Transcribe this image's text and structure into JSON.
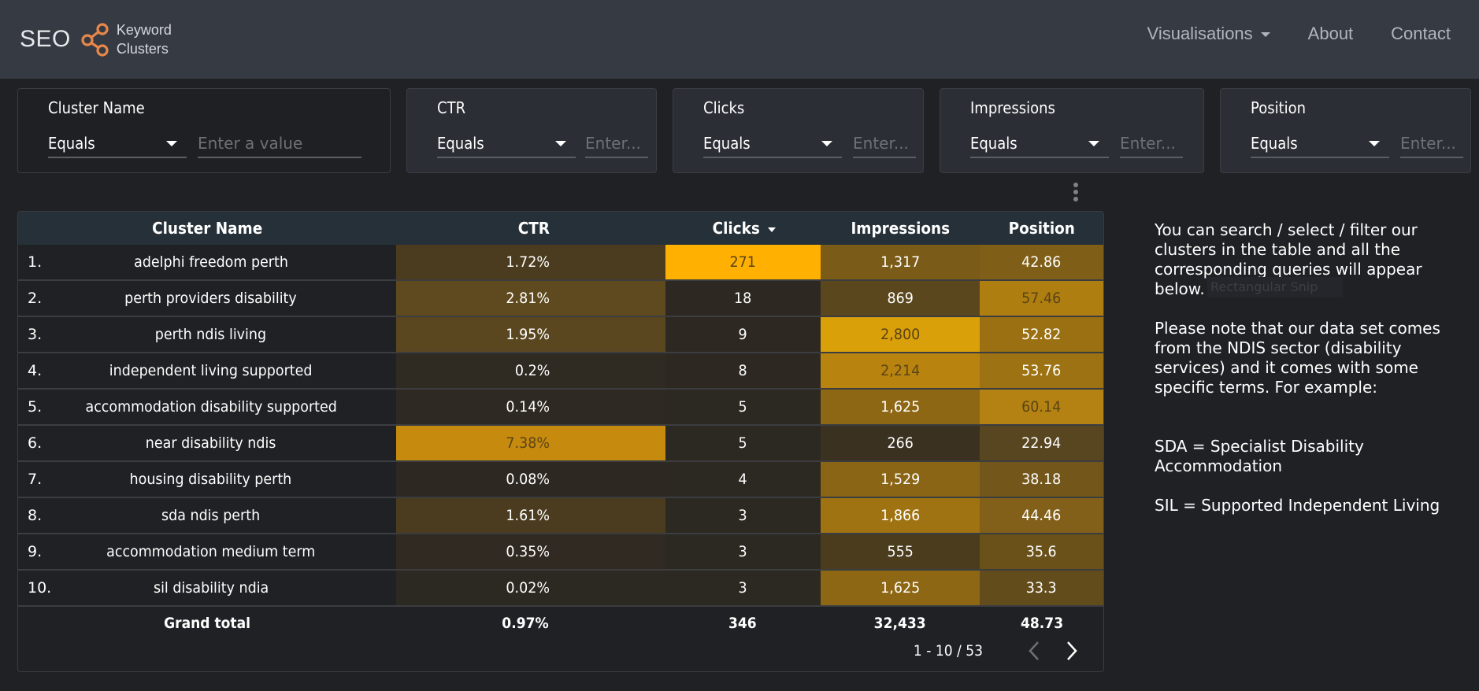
{
  "header": {
    "logo": {
      "seo": "SEO",
      "line1": "Keyword",
      "line2": "Clusters",
      "icon": "share-nodes-icon",
      "accent": "#e8874a"
    },
    "nav": [
      {
        "label": "Visualisations",
        "dropdown": true
      },
      {
        "label": "About"
      },
      {
        "label": "Contact"
      }
    ]
  },
  "filters": [
    {
      "label": "Cluster Name",
      "operator": "Equals",
      "value": "",
      "placeholder": "Enter a value"
    },
    {
      "label": "CTR",
      "operator": "Equals",
      "value": "",
      "placeholder": "Enter..."
    },
    {
      "label": "Clicks",
      "operator": "Equals",
      "value": "",
      "placeholder": "Enter..."
    },
    {
      "label": "Impressions",
      "operator": "Equals",
      "value": "",
      "placeholder": "Enter..."
    },
    {
      "label": "Position",
      "operator": "Equals",
      "value": "",
      "placeholder": "Enter..."
    }
  ],
  "table": {
    "columns": [
      "Cluster Name",
      "CTR",
      "Clicks",
      "Impressions",
      "Position"
    ],
    "sorted_by": "Clicks",
    "sort_direction": "descending",
    "rows": [
      {
        "index": "1.",
        "name": "adelphi freedom perth",
        "ctr": "1.72%",
        "clicks": "271",
        "impressions": "1,317",
        "position": "42.86"
      },
      {
        "index": "2.",
        "name": "perth providers disability",
        "ctr": "2.81%",
        "clicks": "18",
        "impressions": "869",
        "position": "57.46"
      },
      {
        "index": "3.",
        "name": "perth ndis living",
        "ctr": "1.95%",
        "clicks": "9",
        "impressions": "2,800",
        "position": "52.82"
      },
      {
        "index": "4.",
        "name": "independent living supported",
        "ctr": "0.2%",
        "clicks": "8",
        "impressions": "2,214",
        "position": "53.76"
      },
      {
        "index": "5.",
        "name": "accommodation disability supported",
        "ctr": "0.14%",
        "clicks": "5",
        "impressions": "1,625",
        "position": "60.14"
      },
      {
        "index": "6.",
        "name": "near disability ndis",
        "ctr": "7.38%",
        "clicks": "5",
        "impressions": "266",
        "position": "22.94"
      },
      {
        "index": "7.",
        "name": "housing disability perth",
        "ctr": "0.08%",
        "clicks": "4",
        "impressions": "1,529",
        "position": "38.18"
      },
      {
        "index": "8.",
        "name": "sda ndis perth",
        "ctr": "1.61%",
        "clicks": "3",
        "impressions": "1,866",
        "position": "44.46"
      },
      {
        "index": "9.",
        "name": "accommodation medium term",
        "ctr": "0.35%",
        "clicks": "3",
        "impressions": "555",
        "position": "35.6"
      },
      {
        "index": "10.",
        "name": "sil disability ndia",
        "ctr": "0.02%",
        "clicks": "3",
        "impressions": "1,625",
        "position": "33.3"
      }
    ],
    "totals": {
      "label": "Grand total",
      "ctr": "0.97%",
      "clicks": "346",
      "impressions": "32,433",
      "position": "48.73"
    },
    "pagination": {
      "text": "1 - 10 / 53"
    },
    "heat_colors": {
      "ctr": [
        "#4b3b1f",
        "#5e4a1e",
        "#5a4720",
        "#2f2a22",
        "#2e2922",
        "#c68b0e",
        "#2d2822",
        "#4b3b1f",
        "#302a22",
        "#2c2822"
      ],
      "clicks": [
        "#ffb000",
        "#2d2922",
        "#2d2922",
        "#2d2922",
        "#2c2822",
        "#2c2822",
        "#2c2822",
        "#2c2822",
        "#2c2822",
        "#2c2822"
      ],
      "impressions": [
        "#7b5b18",
        "#5a471e",
        "#daa00a",
        "#b8830f",
        "#8e6714",
        "#3a3120",
        "#8a6515",
        "#9f7311",
        "#4a3c1d",
        "#8e6714"
      ],
      "position": [
        "#7f5f18",
        "#ae7e10",
        "#9a7012",
        "#9d7212",
        "#b38212",
        "#584620",
        "#73561a",
        "#82601a",
        "#6a5119",
        "#634c1b"
      ]
    },
    "dark_text_cells": [
      [
        "clicks",
        0
      ],
      [
        "position",
        1
      ],
      [
        "impressions",
        2
      ],
      [
        "impressions",
        3
      ],
      [
        "position",
        4
      ],
      [
        "ctr",
        5
      ]
    ]
  },
  "notes": {
    "paragraph1": "You can search / select / filter our clusters in the table and all the corresponding queries will appear below.",
    "paragraph2": "Please note that our data set comes from the NDIS sector (disability services) and it comes with some specific terms. For example:",
    "sda": "SDA = Specialist Disability Accommodation",
    "sil": "SIL = Supported Independent Living"
  },
  "overlay_tooltip": "Rectangular Snip"
}
